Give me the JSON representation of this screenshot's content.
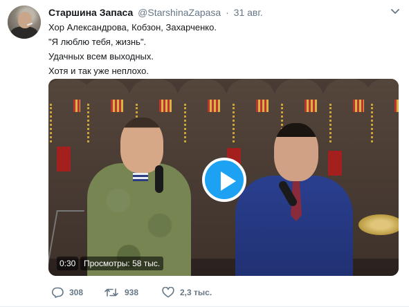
{
  "tweet": {
    "author_name": "Старшина Запаса",
    "author_handle": "@StarshinaZapasa",
    "separator": "·",
    "date": "31 авг.",
    "lines": [
      "Хор Александрова, Кобзон, Захарченко.",
      "\"Я люблю тебя, жизнь\".",
      "Удачных всем выходных.",
      "Хотя и так уже неплохо."
    ]
  },
  "video": {
    "duration": "0:30",
    "views_label": "Просмотры: 58 тыс."
  },
  "actions": {
    "replies": "308",
    "retweets": "938",
    "likes": "2,3 тыс."
  },
  "colors": {
    "accent": "#1da1f2",
    "text": "#14171a",
    "secondary": "#657786"
  },
  "icons": {
    "reply": "reply-icon",
    "retweet": "retweet-icon",
    "like": "heart-icon",
    "caret": "chevron-down-icon",
    "play": "play-icon"
  }
}
